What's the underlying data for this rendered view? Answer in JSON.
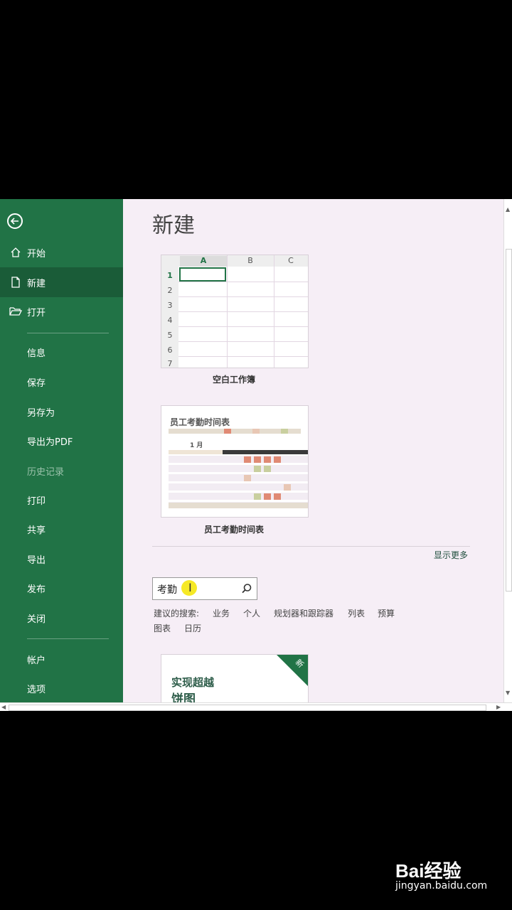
{
  "page": {
    "title": "新建"
  },
  "sidebar": {
    "items": [
      {
        "label": "开始",
        "icon": "home-icon"
      },
      {
        "label": "新建",
        "icon": "new-document-icon",
        "active": true
      },
      {
        "label": "打开",
        "icon": "open-folder-icon"
      },
      {
        "label": "信息"
      },
      {
        "label": "保存"
      },
      {
        "label": "另存为"
      },
      {
        "label": "导出为PDF"
      },
      {
        "label": "历史记录",
        "disabled": true
      },
      {
        "label": "打印"
      },
      {
        "label": "共享"
      },
      {
        "label": "导出"
      },
      {
        "label": "发布"
      },
      {
        "label": "关闭"
      },
      {
        "label": "帐户"
      },
      {
        "label": "选项"
      }
    ]
  },
  "templates": {
    "blank": {
      "caption": "空白工作簿",
      "columns": [
        "A",
        "B",
        "C"
      ],
      "rows": [
        "1",
        "2",
        "3",
        "4",
        "5",
        "6",
        "7"
      ]
    },
    "attendance": {
      "caption": "员工考勤时间表",
      "inner_title": "员工考勤时间表",
      "month": "1 月"
    }
  },
  "show_more": "显示更多",
  "search": {
    "value": "考勤"
  },
  "suggested": {
    "label": "建议的搜索:",
    "items": [
      "业务",
      "个人",
      "规划器和跟踪器",
      "列表",
      "预算",
      "图表",
      "日历"
    ]
  },
  "promo": {
    "line1": "实现超越",
    "line2": "饼图",
    "badge": "新"
  },
  "watermark": {
    "brand": "Bai经验",
    "url": "jingyan.baidu.com"
  },
  "colors": {
    "accent": "#217346",
    "active": "#1a5c38",
    "background": "#f6eef6"
  }
}
